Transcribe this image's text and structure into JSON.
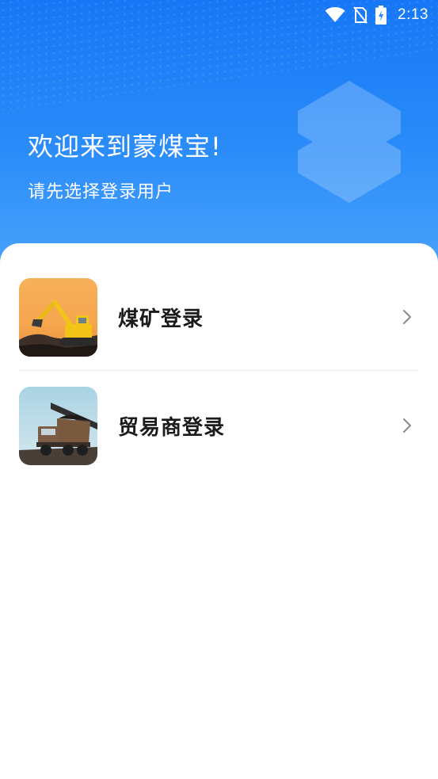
{
  "status_bar": {
    "time": "2:13",
    "icons": [
      "wifi-icon",
      "no-sim-icon",
      "battery-charging-icon"
    ]
  },
  "header": {
    "title": "欢迎来到蒙煤宝!",
    "subtitle": "请先选择登录用户"
  },
  "options": [
    {
      "label": "煤矿登录",
      "image": "excavator-image",
      "icon": "chevron-right-icon"
    },
    {
      "label": "贸易商登录",
      "image": "coal-truck-image",
      "icon": "chevron-right-icon"
    }
  ],
  "colors": {
    "header_top": "#1677f6",
    "header_bottom": "#4aa2fb",
    "text_dark": "#1b1b1b",
    "chevron": "#8a8a8a"
  }
}
